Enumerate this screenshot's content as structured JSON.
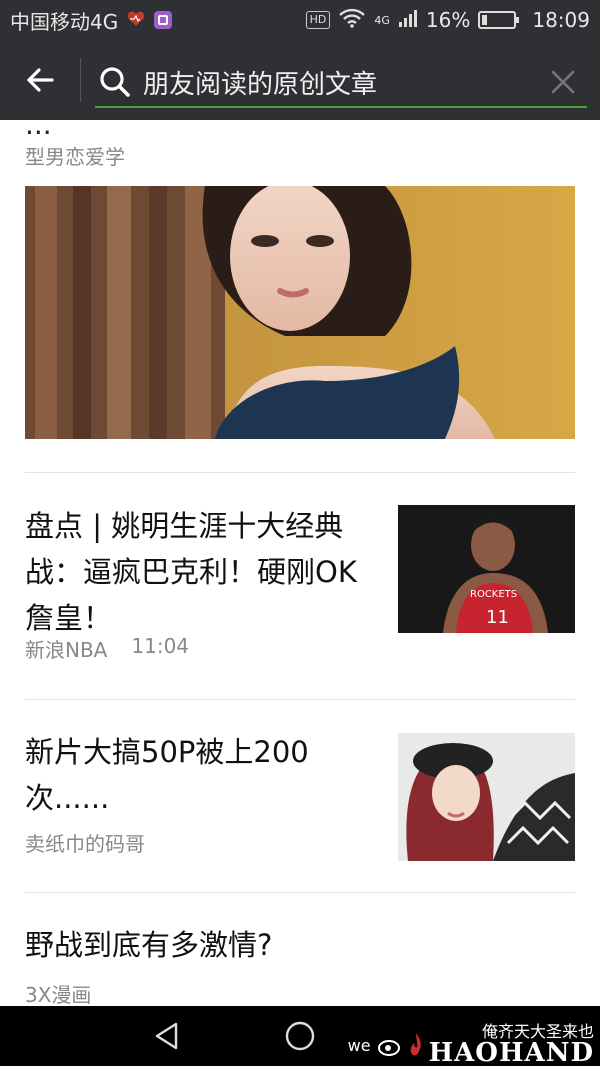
{
  "status_bar": {
    "carrier": "中国移动4G",
    "hd": "HD",
    "network": "4G",
    "battery": "16%",
    "battery_level": 0.16,
    "time": "18:09"
  },
  "search": {
    "query": "朋友阅读的原创文章"
  },
  "results": [
    {
      "title_tail": "...",
      "source": "型男恋爱学"
    },
    {
      "title": "盘点 | 姚明生涯十大经典战：逼疯巴克利！硬刚OK詹皇！",
      "title_lines": [
        "盘点 | 姚明生涯十大经典",
        "战：逼疯巴克利！硬刚OK",
        "詹皇！"
      ],
      "source": "新浪NBA",
      "time": "11:04"
    },
    {
      "title": "新片大搞50P被上200次......",
      "title_lines": [
        "新片大搞50P被上200",
        "次......"
      ],
      "source": "卖纸巾的码哥"
    },
    {
      "title": "野战到底有多激情?",
      "title_lines": [
        "野战到底有多激情?"
      ],
      "source": "3X漫画"
    }
  ],
  "watermark": {
    "text": "俺齐天大圣来也",
    "brand": "HAOHAND",
    "prefix": "we"
  },
  "colors": {
    "header_bg": "#2e3033",
    "search_underline": "#4ca13f",
    "divider": "#e4e4e4",
    "meta_text": "#888888"
  }
}
